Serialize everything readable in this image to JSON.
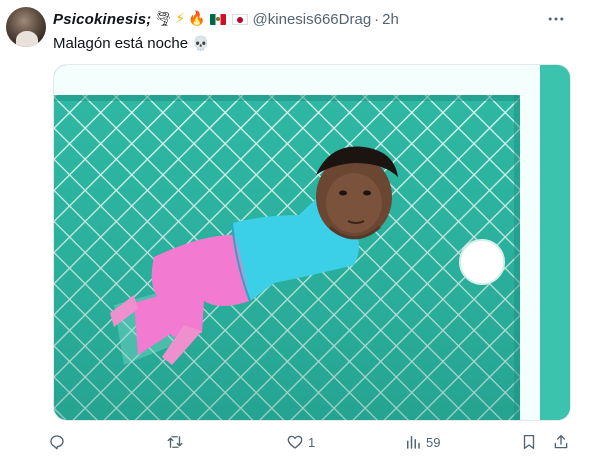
{
  "tweet": {
    "display_name": "Psicokinesis;",
    "name_emojis": [
      "tornado-emoji",
      "lightning-emoji",
      "fire-emoji",
      "mexico-flag",
      "japan-flag"
    ],
    "handle": "@kinesis666Drag",
    "separator": "·",
    "time": "2h",
    "text": "Malagón está noche",
    "text_emoji": "💀"
  },
  "actions": {
    "reply_count": "",
    "retweet_count": "",
    "like_count": "1",
    "views_count": "59"
  },
  "colors": {
    "pool_water": "#2fb8a4",
    "pool_grid": "#ffffff",
    "body_blue": "#3bd0e8",
    "shorts_pink": "#f27ad0",
    "text_secondary": "#536471"
  }
}
